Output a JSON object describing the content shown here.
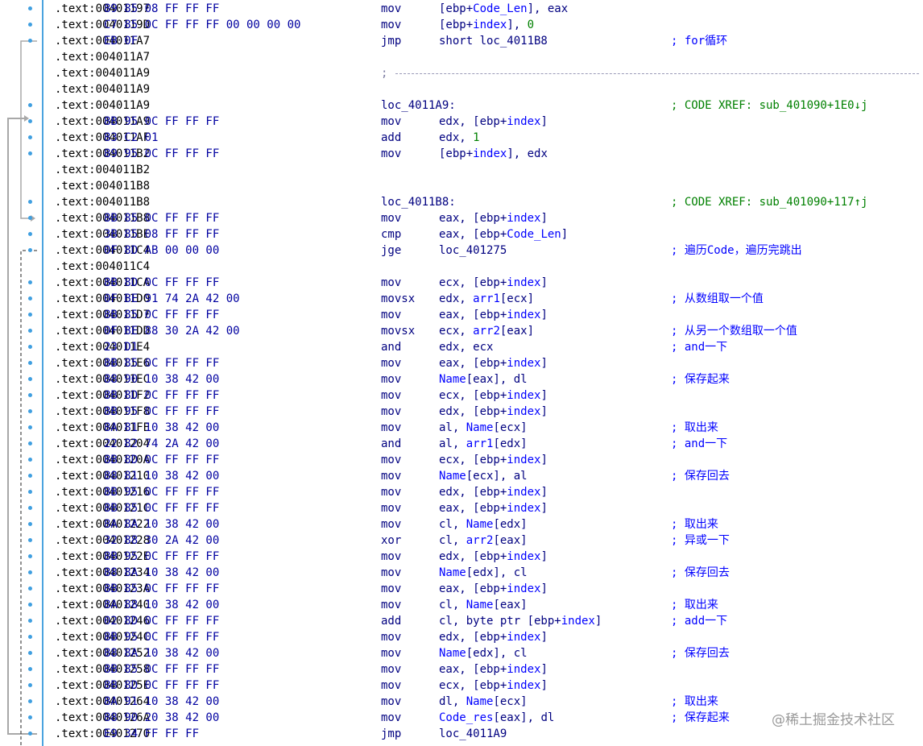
{
  "rows": [
    {
      "addr": ".text:00401197",
      "bytes": "89 85 08 FF FF FF",
      "mnem": "mov",
      "ops": [
        [
          "n",
          "[ebp+"
        ],
        [
          "k",
          "Code_Len"
        ],
        [
          "n",
          "], eax"
        ]
      ],
      "comment": ""
    },
    {
      "addr": ".text:0040119D",
      "bytes": "C7 85 0C FF FF FF 00 00 00 00",
      "mnem": "mov",
      "ops": [
        [
          "n",
          "[ebp+"
        ],
        [
          "k",
          "index"
        ],
        [
          "n",
          "], "
        ],
        [
          "g",
          "0"
        ]
      ],
      "comment": ""
    },
    {
      "addr": ".text:004011A7",
      "bytes": "EB 0F",
      "mnem": "jmp",
      "ops": [
        [
          "n",
          "short loc_4011B8"
        ]
      ],
      "comment": "; for循环"
    },
    {
      "addr": ".text:004011A7",
      "bytes": "",
      "mnem": "",
      "ops": [],
      "comment": ""
    },
    {
      "addr": ".text:004011A9",
      "bytes": "",
      "mnem": "",
      "ops": [],
      "comment": "",
      "separator": ";"
    },
    {
      "addr": ".text:004011A9",
      "bytes": "",
      "mnem": "",
      "ops": [],
      "comment": ""
    },
    {
      "addr": ".text:004011A9",
      "bytes": "",
      "mnem": "",
      "ops": [],
      "label": "loc_4011A9:",
      "comment": "; CODE XREF: sub_401090+1E0↓j",
      "xref": true
    },
    {
      "addr": ".text:004011A9",
      "bytes": "8B 95 0C FF FF FF",
      "mnem": "mov",
      "ops": [
        [
          "n",
          "edx, [ebp+"
        ],
        [
          "k",
          "index"
        ],
        [
          "n",
          "]"
        ]
      ],
      "comment": ""
    },
    {
      "addr": ".text:004011AF",
      "bytes": "83 C2 01",
      "mnem": "add",
      "ops": [
        [
          "n",
          "edx, "
        ],
        [
          "g",
          "1"
        ]
      ],
      "comment": ""
    },
    {
      "addr": ".text:004011B2",
      "bytes": "89 95 0C FF FF FF",
      "mnem": "mov",
      "ops": [
        [
          "n",
          "[ebp+"
        ],
        [
          "k",
          "index"
        ],
        [
          "n",
          "], edx"
        ]
      ],
      "comment": ""
    },
    {
      "addr": ".text:004011B2",
      "bytes": "",
      "mnem": "",
      "ops": [],
      "comment": ""
    },
    {
      "addr": ".text:004011B8",
      "bytes": "",
      "mnem": "",
      "ops": [],
      "comment": ""
    },
    {
      "addr": ".text:004011B8",
      "bytes": "",
      "mnem": "",
      "ops": [],
      "label": "loc_4011B8:",
      "comment": "; CODE XREF: sub_401090+117↑j",
      "xref": true
    },
    {
      "addr": ".text:004011B8",
      "bytes": "8B 85 0C FF FF FF",
      "mnem": "mov",
      "ops": [
        [
          "n",
          "eax, [ebp+"
        ],
        [
          "k",
          "index"
        ],
        [
          "n",
          "]"
        ]
      ],
      "comment": ""
    },
    {
      "addr": ".text:004011BE",
      "bytes": "3B 85 08 FF FF FF",
      "mnem": "cmp",
      "ops": [
        [
          "n",
          "eax, [ebp+"
        ],
        [
          "k",
          "Code_Len"
        ],
        [
          "n",
          "]"
        ]
      ],
      "comment": ""
    },
    {
      "addr": ".text:004011C4",
      "bytes": "0F 8D AB 00 00 00",
      "mnem": "jge",
      "ops": [
        [
          "n",
          "loc_401275"
        ]
      ],
      "comment": "; 遍历Code，遍历完跳出"
    },
    {
      "addr": ".text:004011C4",
      "bytes": "",
      "mnem": "",
      "ops": [],
      "comment": ""
    },
    {
      "addr": ".text:004011CA",
      "bytes": "8B 8D 0C FF FF FF",
      "mnem": "mov",
      "ops": [
        [
          "n",
          "ecx, [ebp+"
        ],
        [
          "k",
          "index"
        ],
        [
          "n",
          "]"
        ]
      ],
      "comment": ""
    },
    {
      "addr": ".text:004011D0",
      "bytes": "0F BE 91 74 2A 42 00",
      "mnem": "movsx",
      "ops": [
        [
          "n",
          "edx, "
        ],
        [
          "k",
          "arr1"
        ],
        [
          "n",
          "[ecx]"
        ]
      ],
      "comment": "; 从数组取一个值"
    },
    {
      "addr": ".text:004011D7",
      "bytes": "8B 85 0C FF FF FF",
      "mnem": "mov",
      "ops": [
        [
          "n",
          "eax, [ebp+"
        ],
        [
          "k",
          "index"
        ],
        [
          "n",
          "]"
        ]
      ],
      "comment": ""
    },
    {
      "addr": ".text:004011DD",
      "bytes": "0F BE 88 30 2A 42 00",
      "mnem": "movsx",
      "ops": [
        [
          "n",
          "ecx, "
        ],
        [
          "k",
          "arr2"
        ],
        [
          "n",
          "[eax]"
        ]
      ],
      "comment": "; 从另一个数组取一个值"
    },
    {
      "addr": ".text:004011E4",
      "bytes": "23 D1",
      "mnem": "and",
      "ops": [
        [
          "n",
          "edx, ecx"
        ]
      ],
      "comment": "; and一下"
    },
    {
      "addr": ".text:004011E6",
      "bytes": "8B 85 0C FF FF FF",
      "mnem": "mov",
      "ops": [
        [
          "n",
          "eax, [ebp+"
        ],
        [
          "k",
          "index"
        ],
        [
          "n",
          "]"
        ]
      ],
      "comment": ""
    },
    {
      "addr": ".text:004011EC",
      "bytes": "88 90 10 38 42 00",
      "mnem": "mov",
      "ops": [
        [
          "k",
          "Name"
        ],
        [
          "n",
          "[eax], dl"
        ]
      ],
      "comment": "; 保存起来"
    },
    {
      "addr": ".text:004011F2",
      "bytes": "8B 8D 0C FF FF FF",
      "mnem": "mov",
      "ops": [
        [
          "n",
          "ecx, [ebp+"
        ],
        [
          "k",
          "index"
        ],
        [
          "n",
          "]"
        ]
      ],
      "comment": ""
    },
    {
      "addr": ".text:004011F8",
      "bytes": "8B 95 0C FF FF FF",
      "mnem": "mov",
      "ops": [
        [
          "n",
          "edx, [ebp+"
        ],
        [
          "k",
          "index"
        ],
        [
          "n",
          "]"
        ]
      ],
      "comment": ""
    },
    {
      "addr": ".text:004011FE",
      "bytes": "8A 81 10 38 42 00",
      "mnem": "mov",
      "ops": [
        [
          "n",
          "al, "
        ],
        [
          "k",
          "Name"
        ],
        [
          "n",
          "[ecx]"
        ]
      ],
      "comment": "; 取出来"
    },
    {
      "addr": ".text:00401204",
      "bytes": "22 82 74 2A 42 00",
      "mnem": "and",
      "ops": [
        [
          "n",
          "al, "
        ],
        [
          "k",
          "arr1"
        ],
        [
          "n",
          "[edx]"
        ]
      ],
      "comment": "; and一下"
    },
    {
      "addr": ".text:0040120A",
      "bytes": "8B 8D 0C FF FF FF",
      "mnem": "mov",
      "ops": [
        [
          "n",
          "ecx, [ebp+"
        ],
        [
          "k",
          "index"
        ],
        [
          "n",
          "]"
        ]
      ],
      "comment": ""
    },
    {
      "addr": ".text:00401210",
      "bytes": "88 81 10 38 42 00",
      "mnem": "mov",
      "ops": [
        [
          "k",
          "Name"
        ],
        [
          "n",
          "[ecx], al"
        ]
      ],
      "comment": "; 保存回去"
    },
    {
      "addr": ".text:00401216",
      "bytes": "8B 95 0C FF FF FF",
      "mnem": "mov",
      "ops": [
        [
          "n",
          "edx, [ebp+"
        ],
        [
          "k",
          "index"
        ],
        [
          "n",
          "]"
        ]
      ],
      "comment": ""
    },
    {
      "addr": ".text:0040121C",
      "bytes": "8B 85 0C FF FF FF",
      "mnem": "mov",
      "ops": [
        [
          "n",
          "eax, [ebp+"
        ],
        [
          "k",
          "index"
        ],
        [
          "n",
          "]"
        ]
      ],
      "comment": ""
    },
    {
      "addr": ".text:00401222",
      "bytes": "8A 8A 10 38 42 00",
      "mnem": "mov",
      "ops": [
        [
          "n",
          "cl, "
        ],
        [
          "k",
          "Name"
        ],
        [
          "n",
          "[edx]"
        ]
      ],
      "comment": "; 取出来"
    },
    {
      "addr": ".text:00401228",
      "bytes": "32 88 30 2A 42 00",
      "mnem": "xor",
      "ops": [
        [
          "n",
          "cl, "
        ],
        [
          "k",
          "arr2"
        ],
        [
          "n",
          "[eax]"
        ]
      ],
      "comment": "; 异或一下"
    },
    {
      "addr": ".text:0040122E",
      "bytes": "8B 95 0C FF FF FF",
      "mnem": "mov",
      "ops": [
        [
          "n",
          "edx, [ebp+"
        ],
        [
          "k",
          "index"
        ],
        [
          "n",
          "]"
        ]
      ],
      "comment": ""
    },
    {
      "addr": ".text:00401234",
      "bytes": "88 8A 10 38 42 00",
      "mnem": "mov",
      "ops": [
        [
          "k",
          "Name"
        ],
        [
          "n",
          "[edx], cl"
        ]
      ],
      "comment": "; 保存回去"
    },
    {
      "addr": ".text:0040123A",
      "bytes": "8B 85 0C FF FF FF",
      "mnem": "mov",
      "ops": [
        [
          "n",
          "eax, [ebp+"
        ],
        [
          "k",
          "index"
        ],
        [
          "n",
          "]"
        ]
      ],
      "comment": ""
    },
    {
      "addr": ".text:00401240",
      "bytes": "8A 88 10 38 42 00",
      "mnem": "mov",
      "ops": [
        [
          "n",
          "cl, "
        ],
        [
          "k",
          "Name"
        ],
        [
          "n",
          "[eax]"
        ]
      ],
      "comment": "; 取出来"
    },
    {
      "addr": ".text:00401246",
      "bytes": "02 8D 0C FF FF FF",
      "mnem": "add",
      "ops": [
        [
          "n",
          "cl, byte ptr [ebp+"
        ],
        [
          "k",
          "index"
        ],
        [
          "n",
          "]"
        ]
      ],
      "comment": "; add一下"
    },
    {
      "addr": ".text:0040124C",
      "bytes": "8B 95 0C FF FF FF",
      "mnem": "mov",
      "ops": [
        [
          "n",
          "edx, [ebp+"
        ],
        [
          "k",
          "index"
        ],
        [
          "n",
          "]"
        ]
      ],
      "comment": ""
    },
    {
      "addr": ".text:00401252",
      "bytes": "88 8A 10 38 42 00",
      "mnem": "mov",
      "ops": [
        [
          "k",
          "Name"
        ],
        [
          "n",
          "[edx], cl"
        ]
      ],
      "comment": "; 保存回去"
    },
    {
      "addr": ".text:00401258",
      "bytes": "8B 85 0C FF FF FF",
      "mnem": "mov",
      "ops": [
        [
          "n",
          "eax, [ebp+"
        ],
        [
          "k",
          "index"
        ],
        [
          "n",
          "]"
        ]
      ],
      "comment": ""
    },
    {
      "addr": ".text:0040125E",
      "bytes": "8B 8D 0C FF FF FF",
      "mnem": "mov",
      "ops": [
        [
          "n",
          "ecx, [ebp+"
        ],
        [
          "k",
          "index"
        ],
        [
          "n",
          "]"
        ]
      ],
      "comment": ""
    },
    {
      "addr": ".text:00401264",
      "bytes": "8A 91 10 38 42 00",
      "mnem": "mov",
      "ops": [
        [
          "n",
          "dl, "
        ],
        [
          "k",
          "Name"
        ],
        [
          "n",
          "[ecx]"
        ]
      ],
      "comment": "; 取出来"
    },
    {
      "addr": ".text:0040126A",
      "bytes": "88 90 20 38 42 00",
      "mnem": "mov",
      "ops": [
        [
          "k",
          "Code_res"
        ],
        [
          "n",
          "[eax], dl"
        ]
      ],
      "comment": "; 保存起来"
    },
    {
      "addr": ".text:00401270",
      "bytes": "E9 34 FF FF FF",
      "mnem": "jmp",
      "ops": [
        [
          "n",
          "loc_4011A9"
        ]
      ],
      "comment": ""
    }
  ],
  "dot_rows": [
    0,
    1,
    2,
    6,
    7,
    8,
    9,
    12,
    13,
    14,
    15,
    17,
    18,
    19,
    20,
    21,
    22,
    23,
    24,
    25,
    26,
    27,
    28,
    29,
    30,
    31,
    32,
    33,
    34,
    35,
    36,
    37,
    38,
    39,
    40,
    41,
    42,
    43,
    44,
    45
  ],
  "watermark": "@稀土掘金技术社区",
  "colors": {
    "address": "#000000",
    "bytes": "#0000a0",
    "mnemonic": "#000080",
    "keyword": "#0000ff",
    "number": "#008000",
    "comment": "#0000ff",
    "xref": "#008000",
    "gutter_line": "#4aa3df",
    "arrow": "#9a9a9a"
  }
}
